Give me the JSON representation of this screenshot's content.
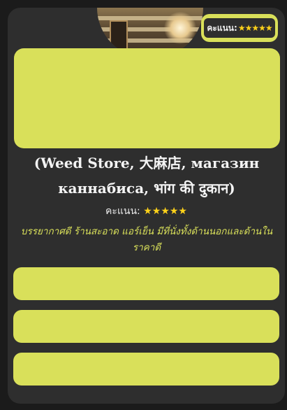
{
  "place": {
    "name": "(Weed Store, 大麻店, магазин каннабиса, भांग की दुकान)",
    "rating_label": "คะแนน:",
    "stars": "★★★★★",
    "description": "บรรยากาศดี ร้านสะอาด แอร์เย็น มีที่นั่งทั้งด้านนอกและด้านใน ราคาดี"
  },
  "badge": {
    "rating_label": "คะแนน:",
    "stars": "★★★★★"
  },
  "colors": {
    "accent": "#d9e05a",
    "card": "#2e2e2e",
    "background": "#1b1b1b",
    "star": "#ffd21a",
    "text": "#f4f4f4"
  },
  "icons": {
    "star": "star-icon"
  }
}
